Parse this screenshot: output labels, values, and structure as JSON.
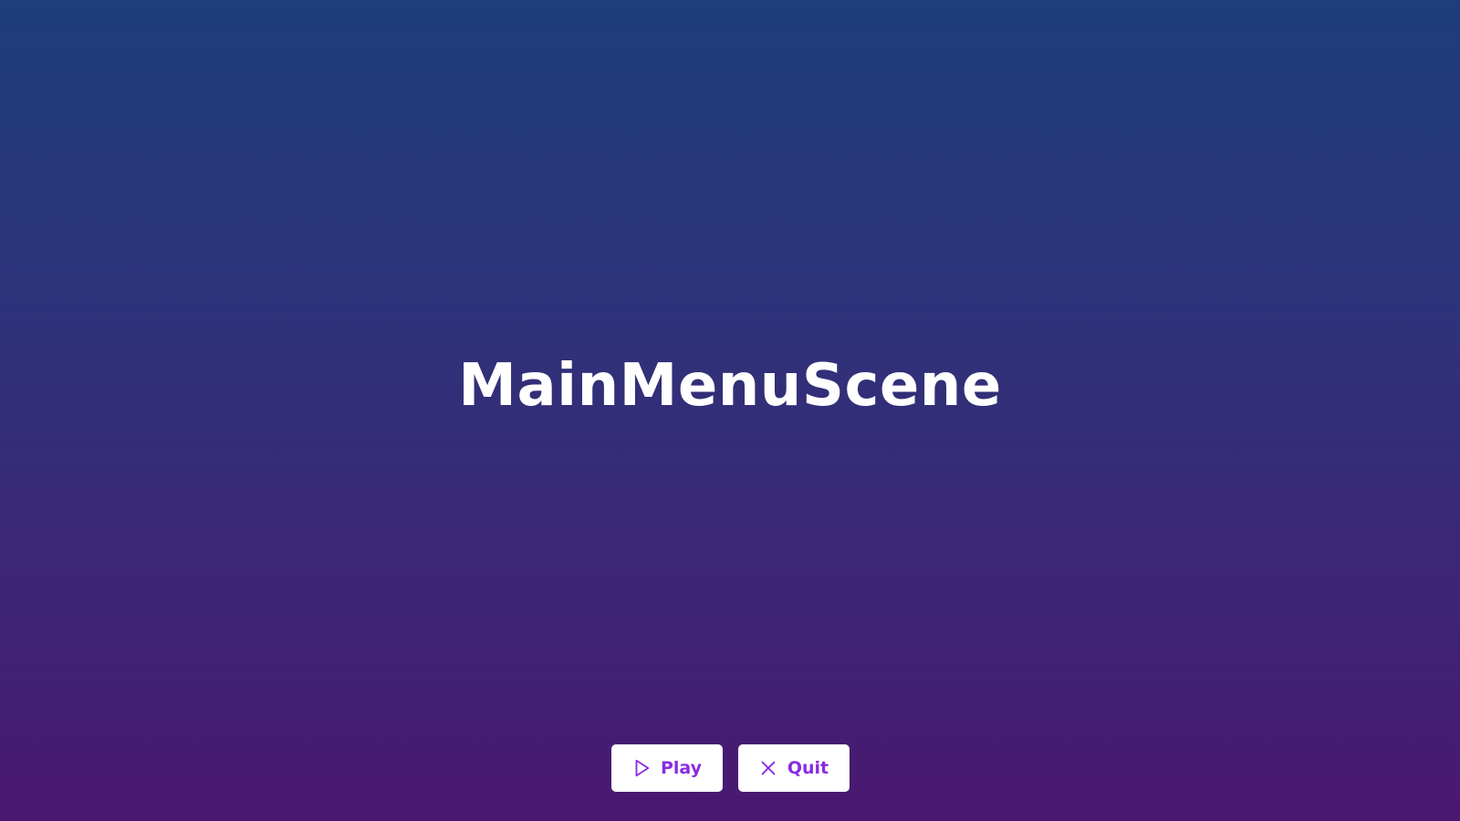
{
  "scene": {
    "title": "MainMenuScene",
    "gradient_top": "#1e3d7a",
    "gradient_bottom": "#4a1870"
  },
  "menu": {
    "play_label": "Play",
    "play_icon": "play-icon",
    "quit_label": "Quit",
    "quit_icon": "close-icon",
    "button_bg": "#ffffff",
    "button_text_color": "#8a2be2"
  }
}
